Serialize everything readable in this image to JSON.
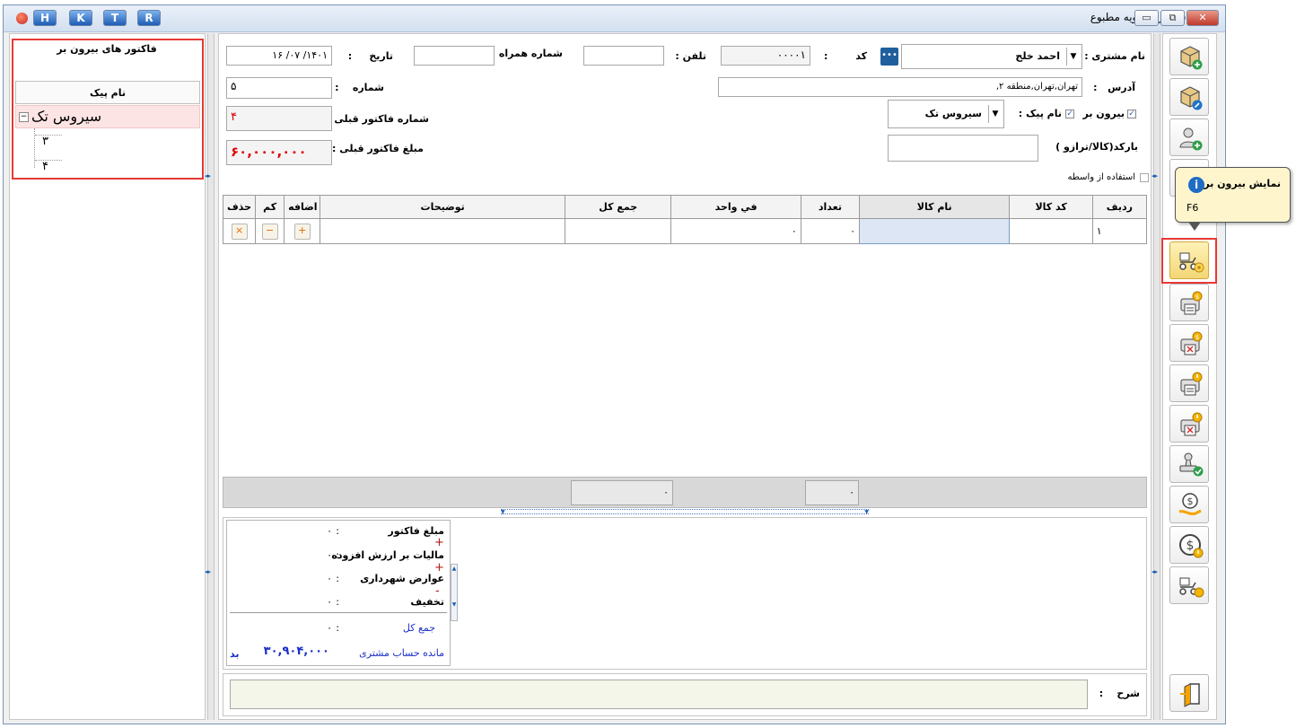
{
  "window": {
    "title": "فاکتور شوفاژ و تهویه مطبوع",
    "tb_buttons": [
      "H",
      "K",
      "T",
      "R"
    ]
  },
  "sidebar": {
    "title": "فاکتور های بیرون بر",
    "column_header": "نام پیک",
    "tree": [
      {
        "label": "سیروس تک",
        "children": [
          "۳",
          "۴"
        ]
      }
    ]
  },
  "form": {
    "customer_label": "نام مشتری :",
    "customer_value": "احمد خلج",
    "code_label": "کد",
    "code_colon": ":",
    "code_value": "۰۰۰۰۱",
    "code_picker": "•••",
    "phone_label": "تلفن",
    "mobile_label": "شماره همراه :",
    "date_label": "تاریخ",
    "date_value": "۱۴۰۱/ ۰۷/ ۱۶",
    "address_label": "آدرس",
    "address_value": "تهران,تهران,منطقه ۲,",
    "number_label": "شماره",
    "number_value": "۵",
    "courier_checkbox_label": "بیرون بر",
    "courier_name_label": "نام پیک :",
    "courier_name_value": "سیروس تک",
    "prev_invoice_label": "شماره فاکتور قبلی :",
    "prev_invoice_value": "۴",
    "barcode_label": "بارکد(کالا/ترازو )",
    "prev_amount_label": "مبلغ فاکتور قبلی :",
    "prev_amount_value": "۶۰,۰۰۰,۰۰۰",
    "use_intermediary_label": "استفاده از واسطه"
  },
  "grid": {
    "headers": [
      "ردیف",
      "کد کالا",
      "نام کالا",
      "تعداد",
      "في واحد",
      "جمع کل",
      "توضیحات",
      "اضافه",
      "کم",
      "حذف"
    ],
    "rows": [
      {
        "row": "۱",
        "code": "",
        "name": "",
        "qty": "۰",
        "unit_price": "۰",
        "total": "",
        "desc": ""
      }
    ],
    "footer_qty": "۰",
    "footer_total": "۰"
  },
  "summary": {
    "rows": [
      {
        "label": "مبلغ فاکتور",
        "colon": ":",
        "value": "۰"
      },
      {
        "label": "مالیات بر ارزش افزوده",
        "colon": ":",
        "value": "۰",
        "sign": "+"
      },
      {
        "label": "عوارض شهرداری",
        "colon": ":",
        "value": "۰",
        "sign": "+"
      },
      {
        "label": "تخفیف",
        "colon": ":",
        "value": "۰",
        "sign": "-"
      }
    ],
    "total_label": "جمع کل",
    "total_value": "۰",
    "balance_label": "مانده حساب مشتری",
    "balance_value": "۳۰,۹۰۴,۰۰۰",
    "balance_status": "بد"
  },
  "description_label": "شرح",
  "tooltip": {
    "title": "نمایش بیرون بر",
    "shortcut": "F6"
  },
  "toolbar_icons": [
    "add-product-icon",
    "edit-product-icon",
    "add-customer-icon",
    "document-icon",
    "show-delivery-icon",
    "print-invoice-icon",
    "delete-print-icon",
    "print-draft-icon",
    "delete-draft-icon",
    "approve-stamp-icon",
    "payment-icon",
    "currency-icon",
    "delivery-icon",
    "exit-icon"
  ],
  "colors": {
    "accent_red": "#e53935",
    "value_red": "#e00000",
    "link_blue": "#1a2ec8",
    "highlight_cell": "#dce6f4",
    "tree_selected": "#fde4e4"
  }
}
